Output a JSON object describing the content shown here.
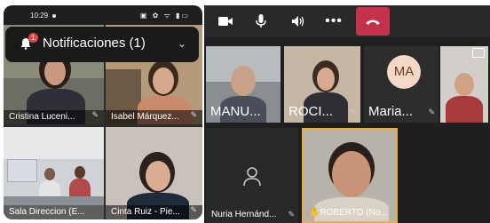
{
  "phone": {
    "status_time": "10:29",
    "status_icons": "▣ ✿ ᯤ ▮▭",
    "notification": {
      "title": "Notificaciones (1)",
      "badge": "1"
    },
    "tiles": [
      {
        "label": "Cristina Luceni..."
      },
      {
        "label": "Isabel Márquez..."
      },
      {
        "label": "Sala Direccion (E..."
      },
      {
        "label": "Cinta Ruiz - Pie..."
      }
    ]
  },
  "desktop": {
    "top_tiles": [
      {
        "name": "MANU..."
      },
      {
        "name": "ROCI..."
      },
      {
        "name": "Maria...",
        "initials": "MA"
      },
      {
        "name": ""
      }
    ],
    "bottom_tiles": [
      {
        "label": "Nuria Hernánd..."
      },
      {
        "label": "✋ROBERTO (No..."
      }
    ]
  },
  "colors": {
    "hangup": "#c4314b",
    "raised_hand_border": "#e8b04b"
  },
  "icons": [
    "camera-icon",
    "microphone-icon",
    "speaker-icon",
    "more-icon",
    "hangup-icon",
    "bell-icon",
    "chevron-down-icon",
    "person-icon",
    "share-screen-icon",
    "muted-mic-icon"
  ]
}
